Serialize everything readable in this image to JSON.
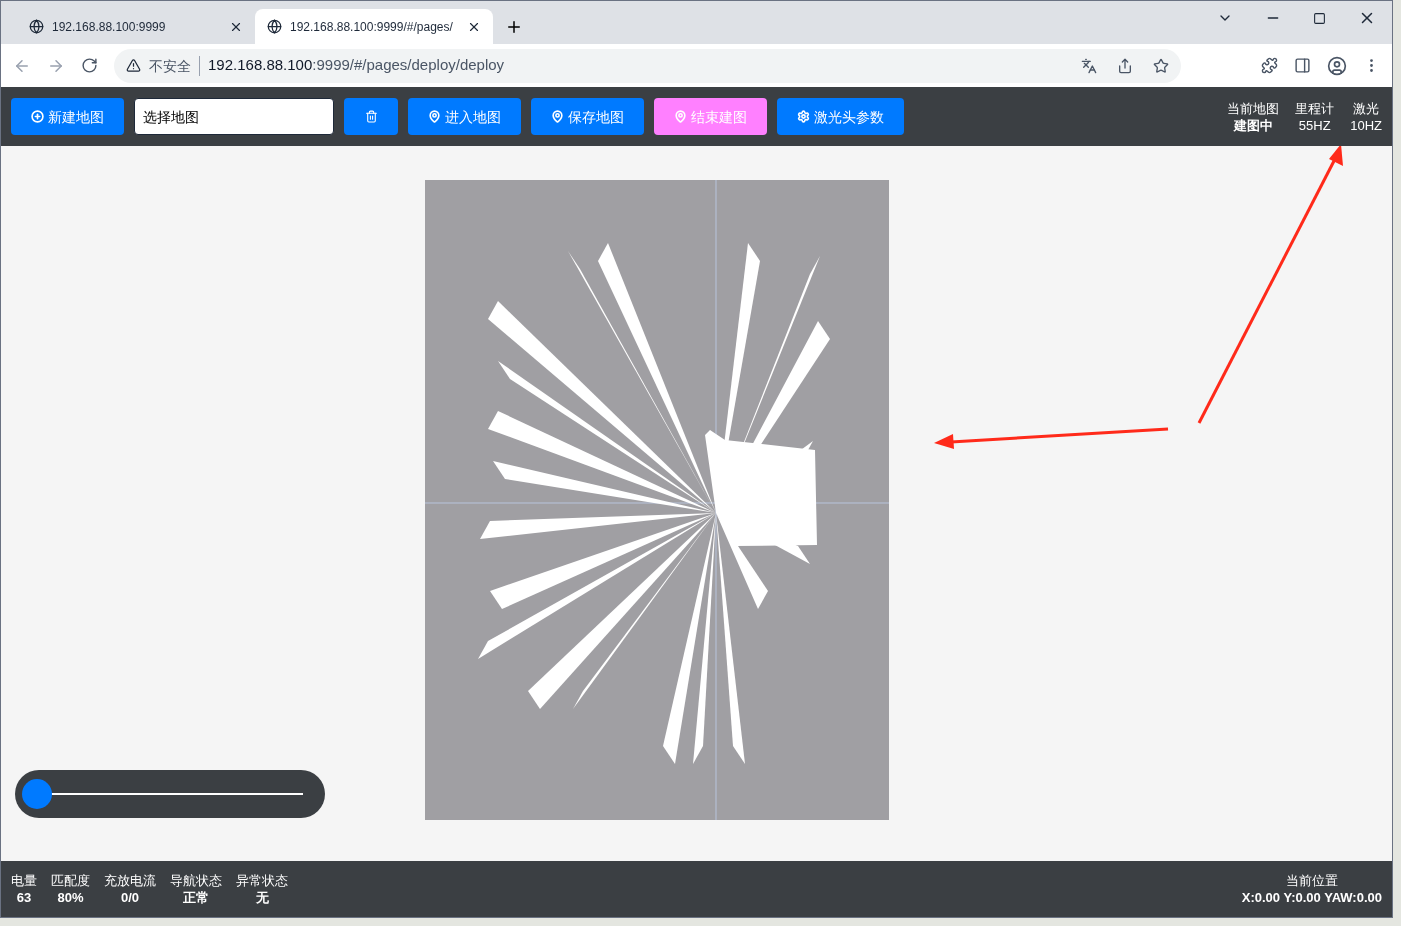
{
  "browser": {
    "tabs": [
      {
        "title": "192.168.88.100:9999",
        "selected": false
      },
      {
        "title": "192.168.88.100:9999/#/pages/",
        "selected": true
      }
    ],
    "security": "不安全",
    "url_host": "192.168.88.100",
    "url_rest": ":9999/#/pages/deploy/deploy"
  },
  "toolbar": {
    "buttons": [
      {
        "kind": "plus",
        "label": "新建地图",
        "color": "#007aff"
      },
      {
        "kind": "field",
        "placeholder": "选择地图"
      },
      {
        "kind": "trash",
        "color": "#007aff"
      },
      {
        "kind": "pin",
        "label": "进入地图",
        "color": "#007aff"
      },
      {
        "kind": "pin",
        "label": "保存地图",
        "color": "#007aff"
      },
      {
        "kind": "pin",
        "label": "结束建图",
        "color": "#ff80ff"
      },
      {
        "kind": "gear",
        "label": "激光头参数",
        "color": "#007aff"
      }
    ],
    "stats": [
      {
        "label": "当前地图",
        "value": "建图中"
      },
      {
        "label": "里程计",
        "value": "55HZ"
      },
      {
        "label": "激光",
        "value": "10HZ"
      }
    ]
  },
  "zoom_slider": {
    "level": 0
  },
  "status_bar": {
    "items": [
      {
        "label": "电量",
        "value": "63"
      },
      {
        "label": "匹配度",
        "value": "80%"
      },
      {
        "label": "充放电流",
        "value": "0/0"
      },
      {
        "label": "导航状态",
        "value": "正常"
      },
      {
        "label": "异常状态",
        "value": "无"
      }
    ],
    "position": {
      "label": "当前位置",
      "value": "X:0.00 Y:0.00 YAW:0.00"
    }
  }
}
